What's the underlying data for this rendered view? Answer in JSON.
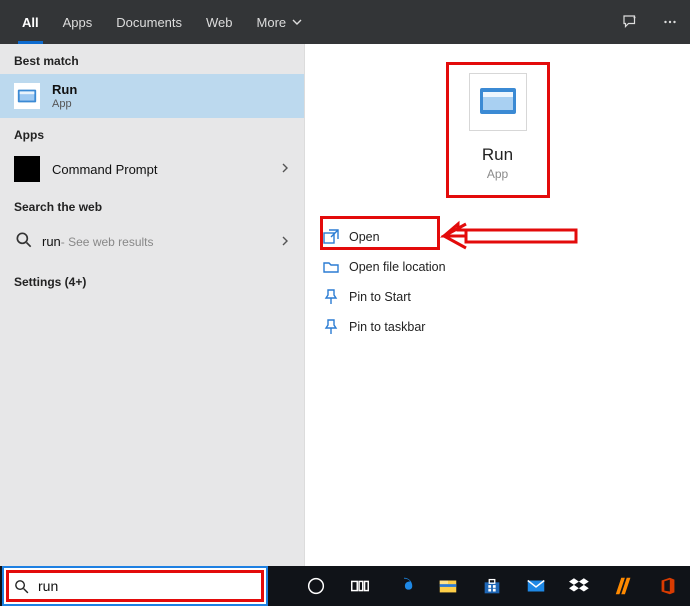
{
  "topbar": {
    "tabs": [
      "All",
      "Apps",
      "Documents",
      "Web",
      "More"
    ]
  },
  "left": {
    "section_best": "Best match",
    "best": {
      "title": "Run",
      "subtitle": "App"
    },
    "section_apps": "Apps",
    "app_result": {
      "title": "Command Prompt"
    },
    "section_web": "Search the web",
    "web_result": {
      "query": "run",
      "suffix": " - See web results"
    },
    "settings_label": "Settings (4+)"
  },
  "right": {
    "hero": {
      "title": "Run",
      "subtitle": "App"
    },
    "actions": {
      "open": "Open",
      "open_file_location": "Open file location",
      "pin_to_start": "Pin to Start",
      "pin_to_taskbar": "Pin to taskbar"
    }
  },
  "search": {
    "value": "run"
  }
}
